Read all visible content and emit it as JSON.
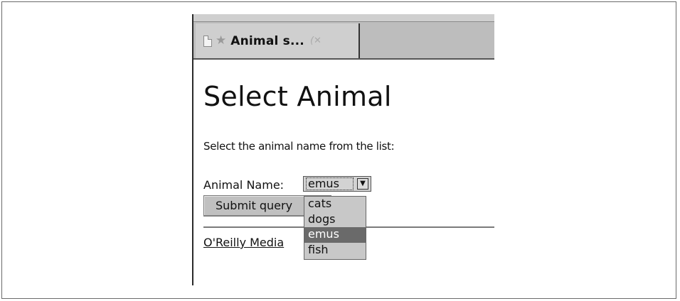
{
  "browser": {
    "tab": {
      "title": "Animal s...",
      "icons": [
        "document-icon",
        "star-icon",
        "close-icon"
      ]
    }
  },
  "page": {
    "heading": "Select Animal",
    "instructions": "Select the animal name from the list:",
    "field_label": "Animal Name:",
    "select": {
      "selected": "emus",
      "options": [
        "cats",
        "dogs",
        "emus",
        "fish"
      ],
      "highlighted_index": 2
    },
    "submit_label": "Submit query",
    "link_text": "O'Reilly Media"
  }
}
